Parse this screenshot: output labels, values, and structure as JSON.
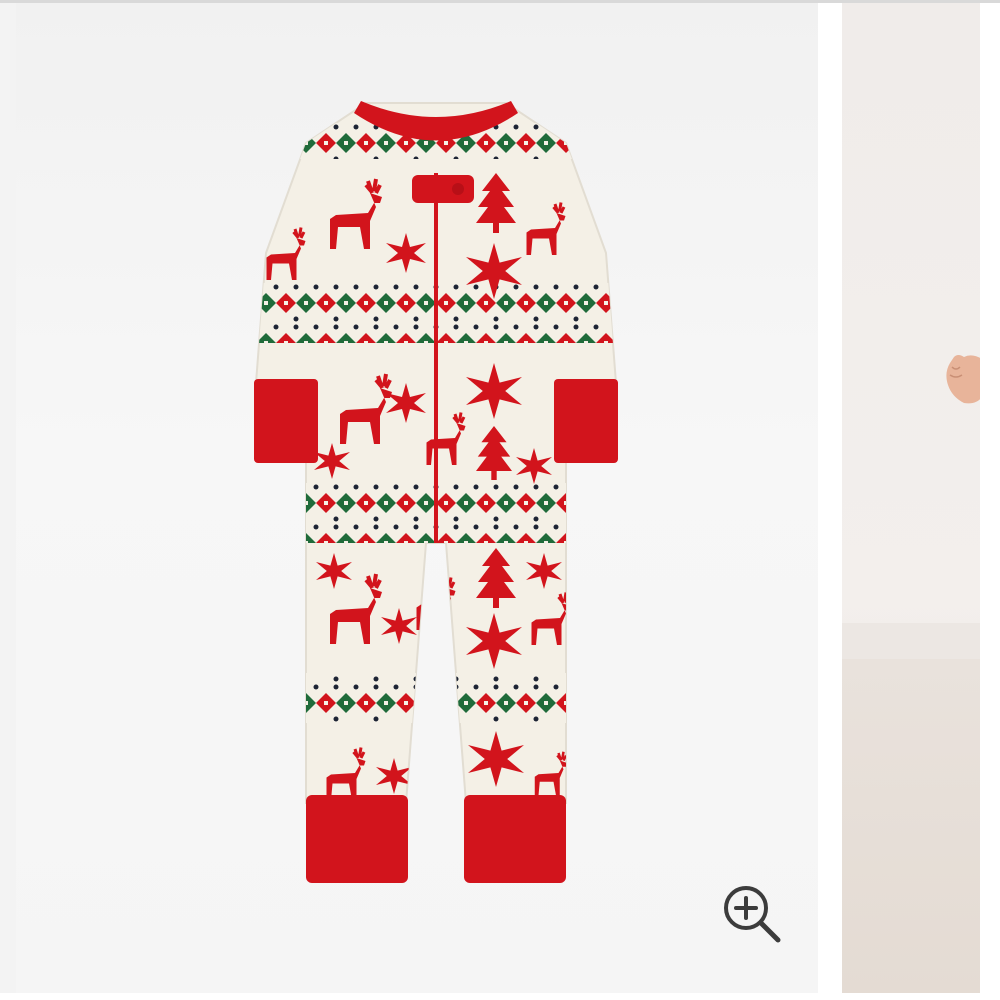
{
  "gallery": {
    "main_image": {
      "alt": "",
      "background": "#f3f3f3"
    },
    "product": {
      "primary_color": "#d2141c",
      "base_color": "#f4f0e6",
      "accent_green": "#1f6b3a",
      "accent_navy": "#1d2434"
    },
    "zoom_button": {
      "icon": "zoom-in-icon",
      "color": "#3c3c3c"
    },
    "next_slide": {
      "background": "#f0ecea"
    }
  }
}
